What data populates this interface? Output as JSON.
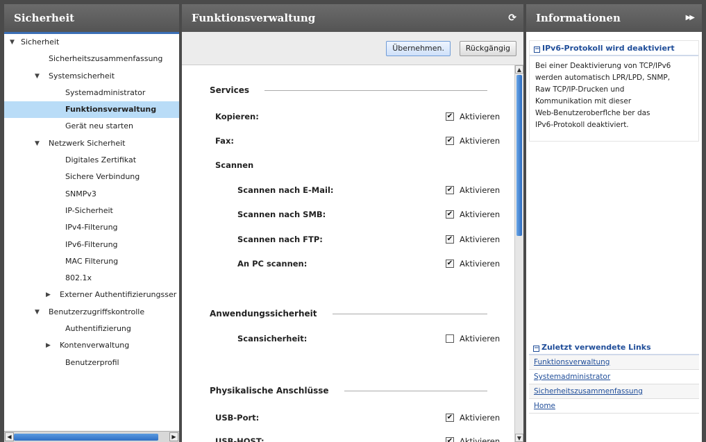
{
  "left": {
    "title": "Sicherheit",
    "tree": [
      {
        "label": "Sicherheit",
        "level": 0,
        "arrow": "▼"
      },
      {
        "label": "Sicherheitszusammenfassung",
        "level": 1
      },
      {
        "label": "Systemsicherheit",
        "level": 1,
        "arrow": "▼"
      },
      {
        "label": "Systemadministrator",
        "level": 2
      },
      {
        "label": "Funktionsverwaltung",
        "level": 2,
        "selected": true
      },
      {
        "label": "Gerät neu starten",
        "level": 2
      },
      {
        "label": "Netzwerk Sicherheit",
        "level": 1,
        "arrow": "▼"
      },
      {
        "label": "Digitales Zertifikat",
        "level": 2
      },
      {
        "label": "Sichere Verbindung",
        "level": 2
      },
      {
        "label": "SNMPv3",
        "level": 2
      },
      {
        "label": "IP-Sicherheit",
        "level": 2
      },
      {
        "label": "IPv4-Filterung",
        "level": 2
      },
      {
        "label": "IPv6-Filterung",
        "level": 2
      },
      {
        "label": "MAC Filterung",
        "level": 2
      },
      {
        "label": "802.1x",
        "level": 2
      },
      {
        "label": "Externer Authentifizierungsser",
        "level": 2,
        "arrow": "▶"
      },
      {
        "label": "Benutzerzugriffskontrolle",
        "level": 1,
        "arrow": "▼"
      },
      {
        "label": "Authentifizierung",
        "level": 2
      },
      {
        "label": "Kontenverwaltung",
        "level": 2,
        "arrow": "▶"
      },
      {
        "label": "Benutzerprofil",
        "level": 2
      }
    ]
  },
  "center": {
    "title": "Funktionsverwaltung",
    "apply_label": "Übernehmen.",
    "undo_label": "Rückgängig",
    "sections": {
      "services": "Services",
      "app_security": "Anwendungssicherheit",
      "physical_ports": "Physikalische Anschlüsse"
    },
    "rows": {
      "kopieren": {
        "label": "Kopieren:",
        "checked": true,
        "option": "Aktivieren"
      },
      "fax": {
        "label": "Fax:",
        "checked": true,
        "option": "Aktivieren"
      },
      "scannen": {
        "label": "Scannen"
      },
      "scan_email": {
        "label": "Scannen nach E-Mail:",
        "checked": true,
        "option": "Aktivieren"
      },
      "scan_smb": {
        "label": "Scannen nach SMB:",
        "checked": true,
        "option": "Aktivieren"
      },
      "scan_ftp": {
        "label": "Scannen nach FTP:",
        "checked": true,
        "option": "Aktivieren"
      },
      "scan_pc": {
        "label": "An PC scannen:",
        "checked": true,
        "option": "Aktivieren"
      },
      "scan_security": {
        "label": "Scansicherheit:",
        "checked": false,
        "option": "Aktivieren"
      },
      "usb_port": {
        "label": "USB-Port:",
        "checked": true,
        "option": "Aktivieren"
      },
      "usb_host": {
        "label": "USB-HOST:",
        "checked": true,
        "option": "Aktivieren"
      }
    }
  },
  "right": {
    "title": "Informationen",
    "info_title": "IPv6-Protokoll wird deaktiviert",
    "info_lines": [
      "Bei einer Deaktivierung von TCP/IPv6",
      "werden automatisch LPR/LPD, SNMP,",
      "Raw TCP/IP-Drucken und",
      "Kommunikation mit dieser",
      "Web-Benutzeroberflche ber das",
      "IPv6-Protokoll deaktiviert."
    ],
    "links_title": "Zuletzt verwendete Links",
    "links": [
      "Funktionsverwaltung",
      "Systemadministrator",
      "Sicherheitszusammenfassung",
      "Home"
    ]
  }
}
